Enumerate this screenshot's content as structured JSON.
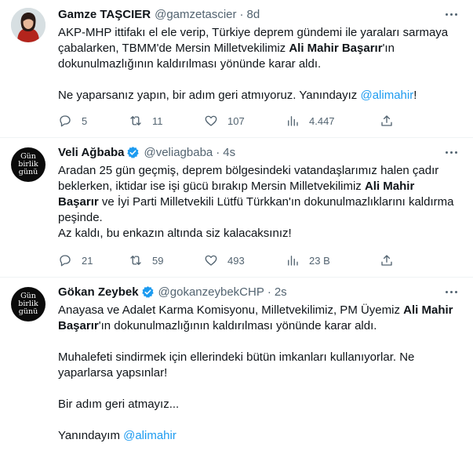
{
  "tweets": [
    {
      "name": "Gamze TAŞCIER",
      "handle": "@gamzetascier",
      "dot": "·",
      "time": "8d",
      "verified": false,
      "avatar_icon": "profile-photo",
      "text_p1_a": "AKP-MHP ittifakı el ele verip, Türkiye deprem gündemi ile yaraları sarmaya çabalarken, TBMM'de Mersin Milletvekilimiz ",
      "text_p1_bold": "Ali Mahir Başarır",
      "text_p1_b": "'ın dokunulmazlığının kaldırılması yönünde karar aldı.",
      "text_p2_a": "Ne yaparsanız yapın, bir adım geri atmıyoruz. Yanındayız ",
      "text_p2_mention": "@alimahir",
      "text_p2_b": "!",
      "replies": "5",
      "retweets": "11",
      "likes": "107",
      "views": "4.447"
    },
    {
      "name": "Veli Ağbaba",
      "handle": "@veliagbaba",
      "dot": "·",
      "time": "4s",
      "verified": true,
      "avatar_lines": [
        "Gün",
        "birlik",
        "günü"
      ],
      "text_a": "Aradan 25 gün geçmiş, deprem bölgesindeki vatandaşlarımız halen çadır beklerken, iktidar ise işi gücü bırakıp Mersin Milletvekilimiz ",
      "text_bold": "Ali Mahir Başarır",
      "text_b": " ve İyi Parti Milletvekili Lütfü Türkkan'ın dokunulmazlıklarını kaldırma peşinde.",
      "text_c": "Az kaldı, bu enkazın altında siz kalacaksınız!",
      "replies": "21",
      "retweets": "59",
      "likes": "493",
      "views": "23 B"
    },
    {
      "name": "Gökan Zeybek",
      "handle": "@gokanzeybekCHP",
      "dot": "·",
      "time": "2s",
      "verified": true,
      "avatar_lines": [
        "Gün",
        "birlik",
        "günü"
      ],
      "text_p1_a": "Anayasa ve Adalet Karma Komisyonu, Milletvekilimiz, PM Üyemiz ",
      "text_p1_bold": "Ali Mahir Başarır",
      "text_p1_b": "'ın dokunulmazlığının kaldırılması yönünde karar aldı.",
      "text_p2": "Muhalefeti sindirmek için ellerindeki bütün imkanları kullanıyorlar. Ne yaparlarsa yapsınlar!",
      "text_p3": "Bir adım geri atmayız...",
      "text_p4_a": "Yanındayım ",
      "text_p4_mention": "@alimahir"
    }
  ],
  "colors": {
    "accent": "#1d9bf0",
    "muted": "#536471",
    "text": "#0f1419",
    "divider": "#eff3f4"
  }
}
